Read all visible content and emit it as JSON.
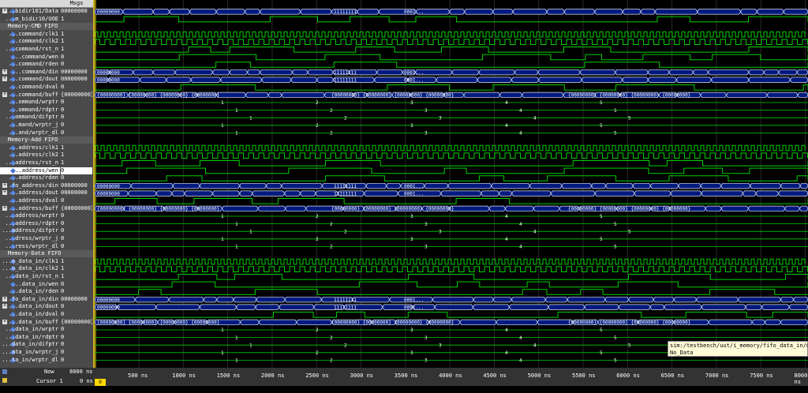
{
  "header": {
    "msgs_label": "Msgs"
  },
  "rows": [
    {
      "name": "...bidir101/Data",
      "value": "00000000",
      "kind": "bus",
      "expand": true,
      "diamond": true
    },
    {
      "name": "...m_bidir10/UOE",
      "value": "1",
      "kind": "bit",
      "diamond": true
    },
    {
      "name": "Memory-CMD FIFO",
      "group": true
    },
    {
      "name": "...command/clk1",
      "value": "1",
      "kind": "clk1",
      "diamond": true
    },
    {
      "name": "...command/clk2",
      "value": "1",
      "kind": "clk2",
      "diamond": true
    },
    {
      "name": "...command/rst_n",
      "value": "1",
      "kind": "bit",
      "diamond": true
    },
    {
      "name": "...command/wen",
      "value": "0",
      "kind": "bit",
      "diamond": true
    },
    {
      "name": "...command/rden",
      "value": "0",
      "kind": "bit",
      "diamond": true
    },
    {
      "name": "...command/din",
      "value": "00000000",
      "kind": "bus",
      "expand": true,
      "diamond": true
    },
    {
      "name": "...command/dout",
      "value": "00000000",
      "kind": "bus",
      "expand": true,
      "diamond": true
    },
    {
      "name": "...command/dval",
      "value": "0",
      "kind": "bit",
      "diamond": true
    },
    {
      "name": "...command/buff",
      "value": "{00000000} ...",
      "kind": "bus",
      "expand": true,
      "diamond": true
    },
    {
      "name": "...ommand/wrptr",
      "value": "0",
      "kind": "num",
      "diamond": true
    },
    {
      "name": "...ommand/rdptr",
      "value": "0",
      "kind": "num",
      "diamond": true
    },
    {
      "name": "...ommand/difptr",
      "value": "0",
      "kind": "num",
      "diamond": true
    },
    {
      "name": "...mand/wrptr_j",
      "value": "0",
      "kind": "num",
      "diamond": true
    },
    {
      "name": "...and/wrptr_dl",
      "value": "0",
      "kind": "num",
      "diamond": true
    },
    {
      "name": "Memory-Add FIFO",
      "group": true
    },
    {
      "name": "...address/clk1",
      "value": "1",
      "kind": "clk1",
      "diamond": true
    },
    {
      "name": "...address/clk2",
      "value": "1",
      "kind": "clk2",
      "diamond": true
    },
    {
      "name": "...address/rst_n",
      "value": "1",
      "kind": "bit",
      "diamond": true
    },
    {
      "name": "...address/wen",
      "value": "0",
      "kind": "bit",
      "diamond": true,
      "selected": true
    },
    {
      "name": "...address/rden",
      "value": "0",
      "kind": "bit",
      "diamond": true
    },
    {
      "name": "...fo_address/din",
      "value": "00000000",
      "kind": "bus",
      "expand": true,
      "diamond": true
    },
    {
      "name": "...address/dout",
      "value": "00000000",
      "kind": "bus",
      "expand": true,
      "diamond": true
    },
    {
      "name": "...address/dval",
      "value": "0",
      "kind": "bit",
      "diamond": true
    },
    {
      "name": "...address/buff",
      "value": "{00000000} ...",
      "kind": "bus",
      "expand": true,
      "diamond": true
    },
    {
      "name": "...address/wrptr",
      "value": "0",
      "kind": "num",
      "diamond": true
    },
    {
      "name": "...address/rdptr",
      "value": "0",
      "kind": "num",
      "diamond": true
    },
    {
      "name": "...address/difptr",
      "value": "0",
      "kind": "num",
      "diamond": true
    },
    {
      "name": "...dress/wrptr_j",
      "value": "0",
      "kind": "num",
      "diamond": true
    },
    {
      "name": "...ress/wrptr_dl",
      "value": "0",
      "kind": "num",
      "diamond": true
    },
    {
      "name": "Memory-Data FIFO",
      "group": true
    },
    {
      "name": "...o_data_in/clk1",
      "value": "1",
      "kind": "clk1",
      "diamond": true
    },
    {
      "name": "...o_data_in/clk2",
      "value": "1",
      "kind": "clk2",
      "diamond": true
    },
    {
      "name": "...data_in/rst_n",
      "value": "1",
      "kind": "bit",
      "diamond": true
    },
    {
      "name": "...data_in/wen",
      "value": "0",
      "kind": "bit",
      "diamond": true
    },
    {
      "name": "...data_in/rden",
      "value": "0",
      "kind": "bit",
      "diamond": true
    },
    {
      "name": "...fo_data_in/din",
      "value": "00000000",
      "kind": "bus",
      "expand": true,
      "diamond": true
    },
    {
      "name": "...data_in/dout",
      "value": "0",
      "kind": "bus",
      "expand": true,
      "diamond": true
    },
    {
      "name": "...data_in/dval",
      "value": "0",
      "kind": "bit",
      "diamond": true
    },
    {
      "name": "...data_in/buff",
      "value": "{00000000} ...",
      "kind": "bus",
      "expand": true,
      "diamond": true
    },
    {
      "name": "...data_in/wrptr",
      "value": "0",
      "kind": "num",
      "diamond": true
    },
    {
      "name": "...data_in/rdptr",
      "value": "0",
      "kind": "num",
      "diamond": true
    },
    {
      "name": "...data_in/difptr",
      "value": "0",
      "kind": "num",
      "diamond": true
    },
    {
      "name": "...ata_in/wrptr_j",
      "value": "0",
      "kind": "num",
      "diamond": true
    },
    {
      "name": "...ta_in/wrptr_dl",
      "value": "0",
      "kind": "num",
      "diamond": true
    }
  ],
  "bus_labels": {
    "data_top": [
      "00000000",
      "11111111",
      "0001..."
    ],
    "cmd_dout": [
      "00000000",
      "00000000",
      "00000000",
      "00110000"
    ],
    "buff": "{00000000} {00000000} {00000000} {00000000}",
    "ptr_digits": [
      "1",
      "2",
      "3",
      "4",
      "5",
      "6",
      "7"
    ]
  },
  "timeline": {
    "ticks": [
      "500 ns",
      "1000 ns",
      "1500 ns",
      "2000 ns",
      "2500 ns",
      "3000 ns",
      "3500 ns",
      "4000 ns",
      "4500 ns",
      "5000 ns",
      "5500 ns",
      "6000 ns",
      "6500 ns",
      "7000 ns",
      "7500 ns",
      "8000 ns"
    ]
  },
  "bottom": {
    "now_label": "Now",
    "now_value": "8000 ns",
    "cursor_label": "Cursor 1",
    "cursor_value": "0 ns",
    "cursor_box": "0 ns"
  },
  "tooltip": {
    "line1": "sim:/testbench/uut/i_memory/fifo_data_in/wrptr",
    "line2": "No_Data"
  },
  "colors": {
    "wave": "#00d000",
    "bus_fill": "#001a80",
    "grid": "#2a2a2a",
    "select": "#ffffff"
  }
}
